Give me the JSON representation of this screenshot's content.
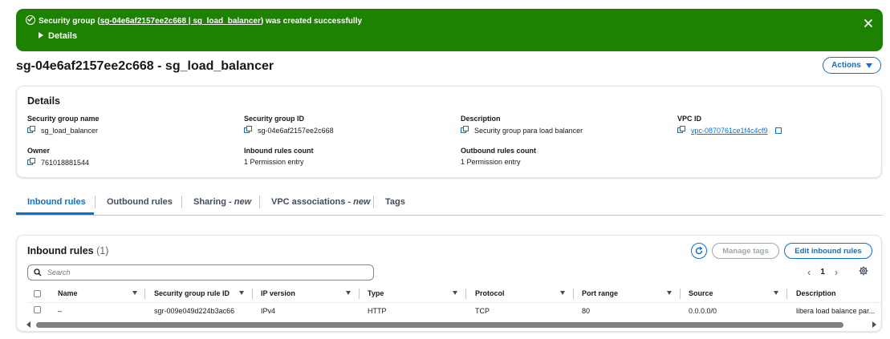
{
  "flash": {
    "message_prefix": "Security group (",
    "message_link": "sg-04e6af2157ee2c668 | sg_load_balancer",
    "message_suffix": ") was created successfully",
    "details_label": "Details",
    "icon": "success-check-icon",
    "close_icon": "close-icon",
    "color": "#1d8102"
  },
  "page": {
    "title": "sg-04e6af2157ee2c668 - sg_load_balancer",
    "actions_label": "Actions"
  },
  "details": {
    "heading": "Details",
    "fields": {
      "sg_name": {
        "label": "Security group name",
        "value": "sg_load_balancer"
      },
      "sg_id": {
        "label": "Security group ID",
        "value": "sg-04e6af2157ee2c668"
      },
      "description": {
        "label": "Description",
        "value": "Security group para load balancer"
      },
      "vpc_id": {
        "label": "VPC ID",
        "value": "vpc-0870761ce1f4c4cf9"
      },
      "owner": {
        "label": "Owner",
        "value": "761018881544"
      },
      "inbound_count": {
        "label": "Inbound rules count",
        "value": "1 Permission entry"
      },
      "outbound_count": {
        "label": "Outbound rules count",
        "value": "1 Permission entry"
      }
    }
  },
  "tabs": [
    {
      "label": "Inbound rules",
      "active": true
    },
    {
      "label": "Outbound rules"
    },
    {
      "label": "Sharing - ",
      "suffix": "new"
    },
    {
      "label": "VPC associations - ",
      "suffix": "new"
    },
    {
      "label": "Tags"
    }
  ],
  "inbound": {
    "heading": "Inbound rules",
    "count": "(1)",
    "manage_tags_label": "Manage tags",
    "edit_label": "Edit inbound rules",
    "search_placeholder": "Search",
    "page_number": "1",
    "columns": [
      "Name",
      "Security group rule ID",
      "IP version",
      "Type",
      "Protocol",
      "Port range",
      "Source",
      "Description"
    ],
    "rows": [
      {
        "name": "–",
        "rule_id": "sgr-009e049d224b3ac66",
        "ip_version": "IPv4",
        "type": "HTTP",
        "protocol": "TCP",
        "port_range": "80",
        "source": "0.0.0.0/0",
        "description": "libera load balance par..."
      }
    ]
  },
  "accent_color": "#0972d3"
}
